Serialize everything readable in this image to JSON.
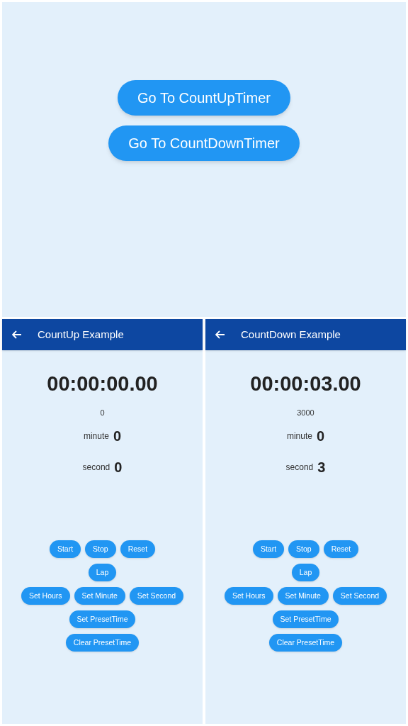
{
  "home": {
    "buttons": [
      "Go To CountUpTimer",
      "Go To CountDownTimer"
    ]
  },
  "screens": [
    {
      "title": "CountUp Example",
      "time": "00:00:00.00",
      "millis": "0",
      "minute_label": "minute",
      "minute": "0",
      "second_label": "second",
      "second": "0",
      "button_rows": [
        [
          "Start",
          "Stop",
          "Reset"
        ],
        [
          "Lap"
        ],
        [
          "Set Hours",
          "Set Minute",
          "Set Second"
        ],
        [
          "Set PresetTime"
        ],
        [
          "Clear PresetTime"
        ]
      ]
    },
    {
      "title": "CountDown Example",
      "time": "00:00:03.00",
      "millis": "3000",
      "minute_label": "minute",
      "minute": "0",
      "second_label": "second",
      "second": "3",
      "button_rows": [
        [
          "Start",
          "Stop",
          "Reset"
        ],
        [
          "Lap"
        ],
        [
          "Set Hours",
          "Set Minute",
          "Set Second"
        ],
        [
          "Set PresetTime"
        ],
        [
          "Clear PresetTime"
        ]
      ]
    }
  ]
}
